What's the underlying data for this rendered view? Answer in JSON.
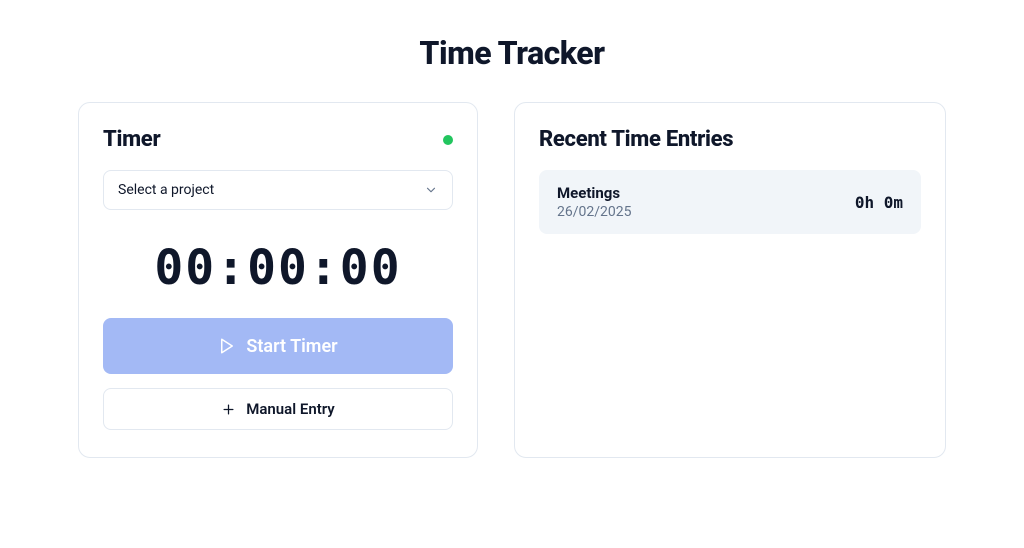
{
  "page": {
    "title": "Time Tracker"
  },
  "timer": {
    "card_title": "Timer",
    "status": "active",
    "project_select": {
      "placeholder": "Select a project",
      "selected": null
    },
    "display": "00:00:00",
    "start_button_label": "Start Timer",
    "manual_entry_label": "Manual Entry"
  },
  "entries": {
    "card_title": "Recent Time Entries",
    "items": [
      {
        "project": "Meetings",
        "date": "26/02/2025",
        "duration": "0h 0m"
      }
    ]
  },
  "colors": {
    "status_active": "#22c55e",
    "primary_button": "#a3b9f5",
    "muted_bg": "#f1f5f9",
    "border": "#e2e8f0",
    "text_muted": "#64748b"
  }
}
